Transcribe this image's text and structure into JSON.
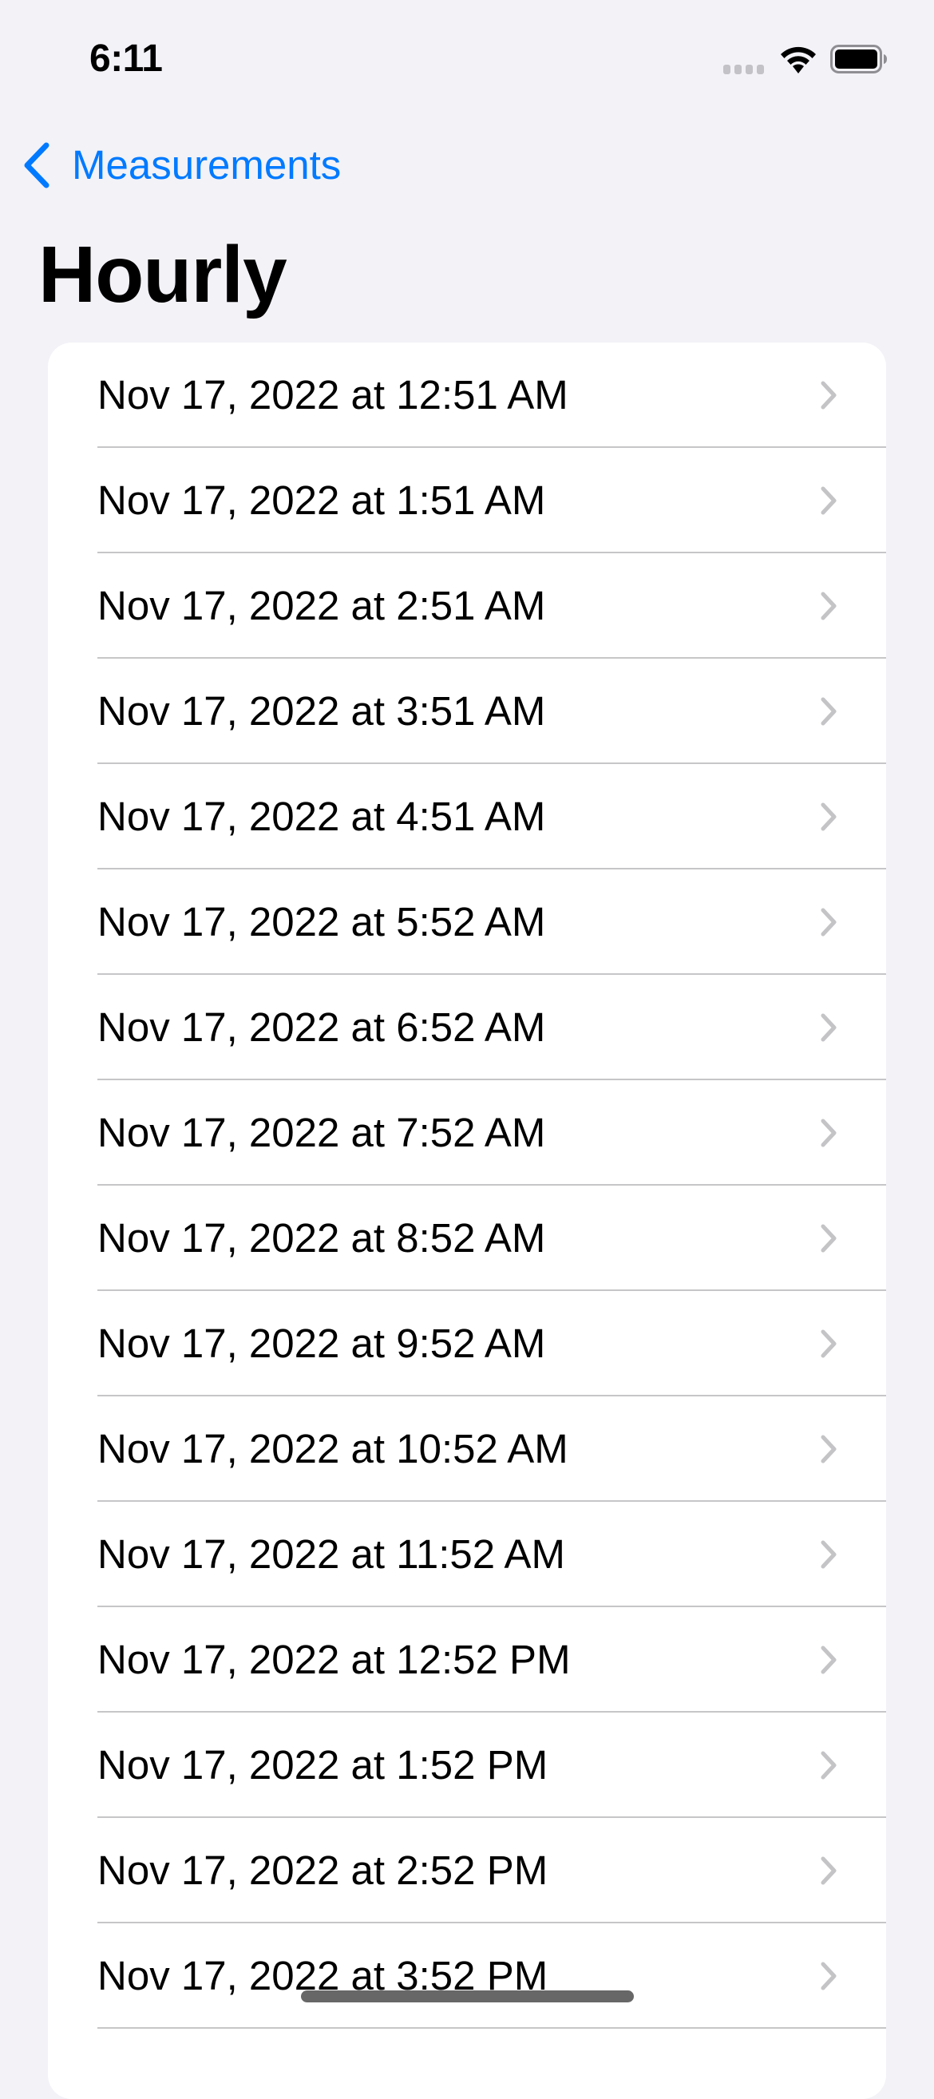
{
  "status_bar": {
    "time": "6:11",
    "signal": "no-signal",
    "wifi": "wifi-full",
    "battery": "battery-full"
  },
  "nav": {
    "back_label": "Measurements",
    "back_icon": "chevron-left-icon",
    "title": "Hourly"
  },
  "colors": {
    "accent": "#007AFF",
    "background": "#F2F2F7",
    "card": "#FFFFFF",
    "separator": "#C6C6C8",
    "chevron": "#C4C4C7"
  },
  "list": {
    "row_icon": "chevron-right-icon",
    "items": [
      {
        "label": "Nov 17, 2022 at 12:51 AM"
      },
      {
        "label": "Nov 17, 2022 at 1:51 AM"
      },
      {
        "label": "Nov 17, 2022 at 2:51 AM"
      },
      {
        "label": "Nov 17, 2022 at 3:51 AM"
      },
      {
        "label": "Nov 17, 2022 at 4:51 AM"
      },
      {
        "label": "Nov 17, 2022 at 5:52 AM"
      },
      {
        "label": "Nov 17, 2022 at 6:52 AM"
      },
      {
        "label": "Nov 17, 2022 at 7:52 AM"
      },
      {
        "label": "Nov 17, 2022 at 8:52 AM"
      },
      {
        "label": "Nov 17, 2022 at 9:52 AM"
      },
      {
        "label": "Nov 17, 2022 at 10:52 AM"
      },
      {
        "label": "Nov 17, 2022 at 11:52 AM"
      },
      {
        "label": "Nov 17, 2022 at 12:52 PM"
      },
      {
        "label": "Nov 17, 2022 at 1:52 PM"
      },
      {
        "label": "Nov 17, 2022 at 2:52 PM"
      },
      {
        "label": "Nov 17, 2022 at 3:52 PM"
      }
    ]
  }
}
